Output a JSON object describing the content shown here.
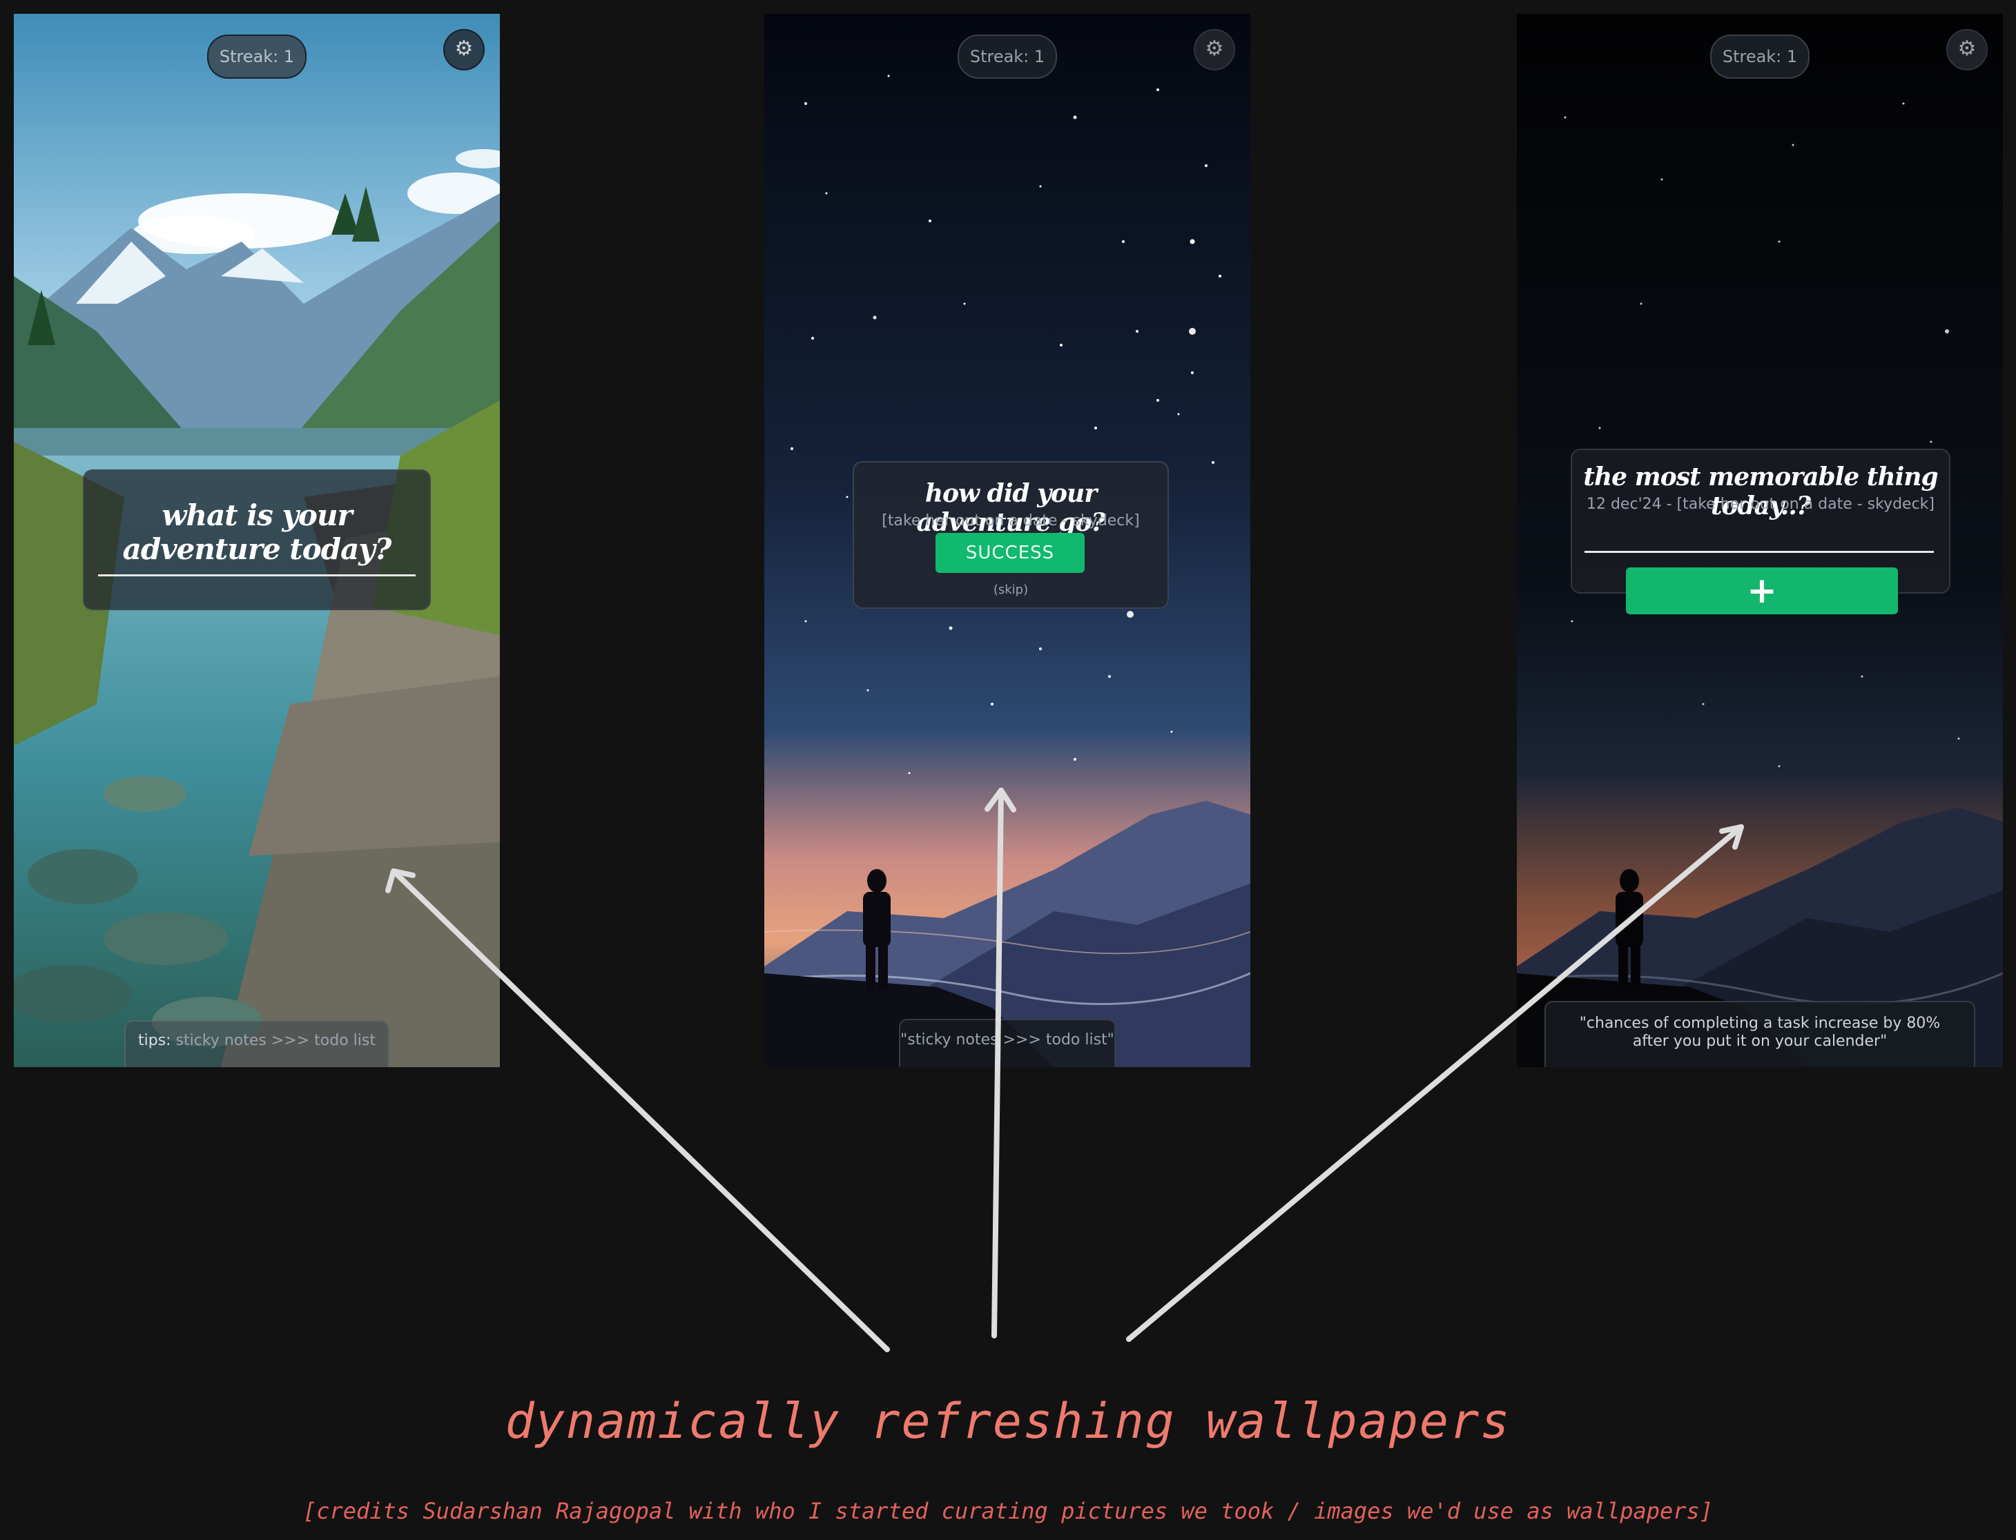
{
  "phones": [
    {
      "streak": "Streak: 1",
      "settings_icon": "gear-icon",
      "prompt": "what is your adventure today?",
      "tip_prefix": "tips:",
      "tip": "sticky notes >>> todo list",
      "wallpaper": "mountain-lake-path"
    },
    {
      "streak": "Streak: 1",
      "settings_icon": "gear-icon",
      "prompt": "how did your adventure go?",
      "subtitle": "[take her out on a date - skydeck]",
      "success_label": "SUCCESS",
      "skip_label": "(skip)",
      "tip": "\"sticky notes >>> todo list\"",
      "wallpaper": "starry-night-silhouette"
    },
    {
      "streak": "Streak: 1",
      "settings_icon": "gear-icon",
      "prompt": "the most memorable thing today..?",
      "subtitle": "12 dec'24 - [take her out on a date - skydeck]",
      "add_label": "+",
      "tip_line1": "\"chances of completing a task increase by 80%",
      "tip_line2": "after you put it on your calender\"",
      "wallpaper": "dark-night-silhouette"
    }
  ],
  "caption": "dynamically refreshing wallpapers",
  "credits": "[credits Sudarshan Rajagopal with who I started curating pictures we took / images we'd use as wallpapers]",
  "colors": {
    "background": "#121212",
    "accent_green": "#10b96e",
    "caption": "#ee7a6d"
  }
}
